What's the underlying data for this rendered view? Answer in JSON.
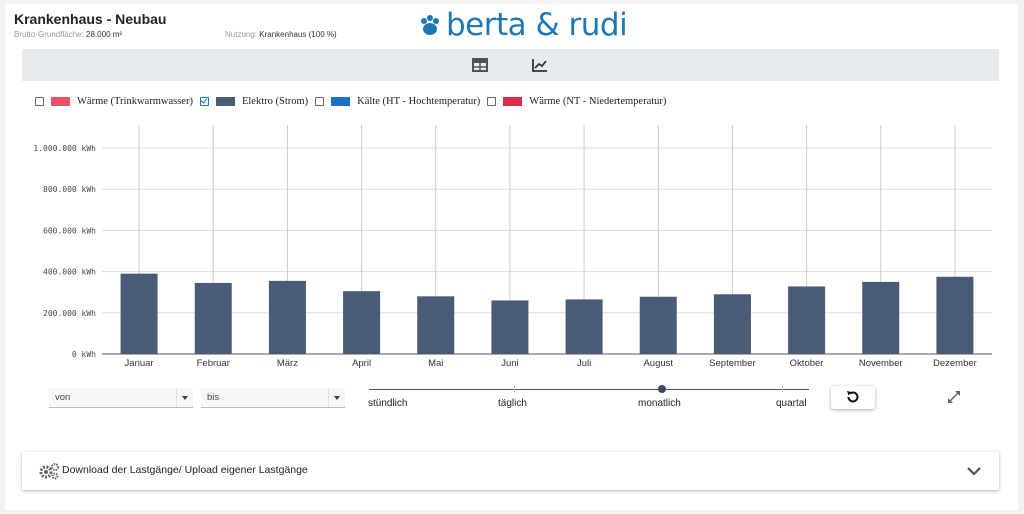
{
  "header": {
    "title": "Krankenhaus - Neubau",
    "bgf_label": "Brutto-Grundfläche:",
    "bgf_value": "28.000 m²",
    "usage_label": "Nutzung:",
    "usage_value": "Krankenhaus (100 %)",
    "logo_text": "berta & rudi"
  },
  "toolbar": {
    "table_icon": "table-icon",
    "chart_icon": "line-chart-icon"
  },
  "legend": [
    {
      "label": "Wärme (Trinkwarmwasser)",
      "color": "#e8536a",
      "checked": false
    },
    {
      "label": "Elektro (Strom)",
      "color": "#4a5b78",
      "checked": true
    },
    {
      "label": "Kälte (HT - Hochtemperatur)",
      "color": "#1a73c9",
      "checked": false
    },
    {
      "label": "Wärme (NT - Niedertemperatur)",
      "color": "#dc2a48",
      "checked": false
    }
  ],
  "chart_data": {
    "type": "bar",
    "categories": [
      "Januar",
      "Februar",
      "März",
      "April",
      "Mai",
      "Juni",
      "Juli",
      "August",
      "September",
      "Oktober",
      "November",
      "Dezember"
    ],
    "series": [
      {
        "name": "Elektro (Strom)",
        "values": [
          390000,
          345000,
          355000,
          305000,
          280000,
          260000,
          265000,
          278000,
          290000,
          328000,
          350000,
          375000
        ]
      }
    ],
    "ylim": [
      0,
      1000000
    ],
    "yticks": [
      "0 kWh",
      "200.000 kWh",
      "400.000 kWh",
      "600.000 kWh",
      "800.000 kWh",
      "1.000.000 kWh"
    ],
    "ytick_values": [
      0,
      200000,
      400000,
      600000,
      800000,
      1000000
    ],
    "color": "#4a5b78",
    "grid": true
  },
  "controls": {
    "from_placeholder": "von",
    "to_placeholder": "bis",
    "slider_labels": [
      "stündlich",
      "täglich",
      "monatlich",
      "quartal"
    ],
    "slider_value": "monatlich"
  },
  "accordion": {
    "label": "Download der Lastgänge/ Upload eigener Lastgänge"
  }
}
